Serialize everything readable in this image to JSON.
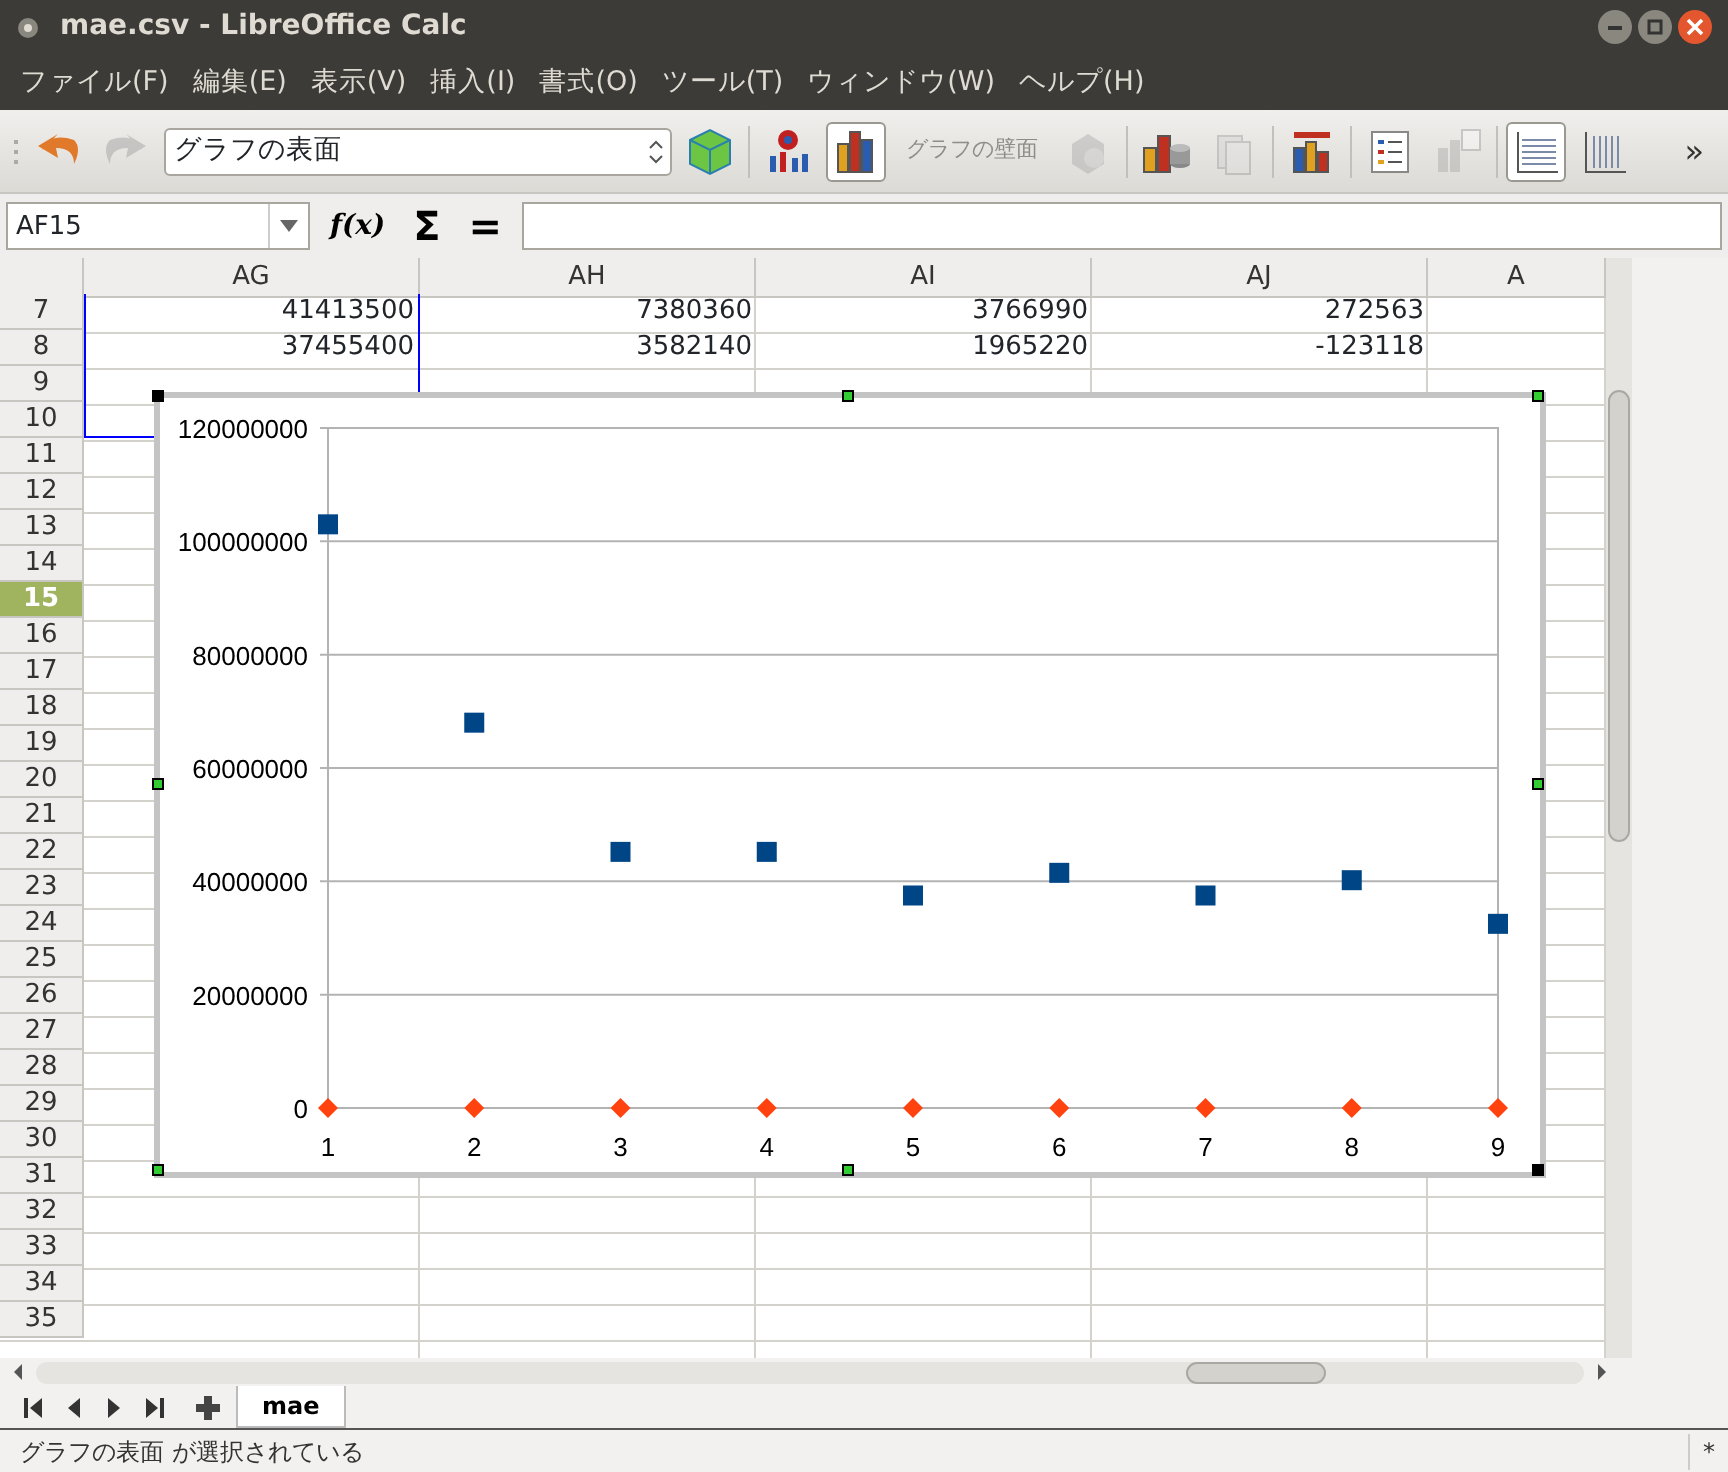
{
  "window": {
    "title": "mae.csv - LibreOffice Calc"
  },
  "menu": [
    {
      "label": "ファイル(F)"
    },
    {
      "label": "編集(E)"
    },
    {
      "label": "表示(V)"
    },
    {
      "label": "挿入(I)"
    },
    {
      "label": "書式(O)"
    },
    {
      "label": "ツール(T)"
    },
    {
      "label": "ウィンドウ(W)"
    },
    {
      "label": "ヘルプ(H)"
    }
  ],
  "toolbar": {
    "items": [
      {
        "kind": "undo",
        "disabled": false,
        "selected": false
      },
      {
        "kind": "redo",
        "disabled": true,
        "selected": false
      },
      {
        "kind": "select",
        "value": "グラフの表面"
      },
      {
        "kind": "cube",
        "disabled": false,
        "selected": false
      },
      {
        "kind": "separator"
      },
      {
        "kind": "charttype",
        "disabled": false,
        "selected": false
      },
      {
        "kind": "bars",
        "disabled": false,
        "selected": true
      },
      {
        "kind": "text",
        "label": "グラフの壁面",
        "disabled": true
      },
      {
        "kind": "threed",
        "disabled": true,
        "selected": false
      },
      {
        "kind": "separator"
      },
      {
        "kind": "datatable",
        "disabled": false,
        "selected": false
      },
      {
        "kind": "sheet",
        "disabled": true,
        "selected": false
      },
      {
        "kind": "separator"
      },
      {
        "kind": "title",
        "disabled": false,
        "selected": false
      },
      {
        "kind": "separator"
      },
      {
        "kind": "legend",
        "disabled": false,
        "selected": false
      },
      {
        "kind": "legendpos",
        "disabled": true,
        "selected": false
      },
      {
        "kind": "separator"
      },
      {
        "kind": "hgrid",
        "disabled": false,
        "selected": true
      },
      {
        "kind": "vgrid",
        "disabled": false,
        "selected": false
      },
      {
        "kind": "more",
        "label": "»"
      }
    ]
  },
  "formula_bar": {
    "name_box": "AF15",
    "function_button": "f(x)",
    "sum_button": "Σ",
    "equals_button": "="
  },
  "sheet": {
    "columns": [
      "AG",
      "AH",
      "AI",
      "AJ",
      "A"
    ],
    "rows": [
      {
        "number": "7",
        "selected": false,
        "range_marked": true,
        "cells": [
          "41413500",
          "7380360",
          "3766990",
          "272563",
          ""
        ]
      },
      {
        "number": "8",
        "selected": false,
        "range_marked": true,
        "cells": [
          "37455400",
          "3582140",
          "1965220",
          "-123118",
          ""
        ]
      },
      {
        "number": "9",
        "selected": false,
        "range_marked": true
      },
      {
        "number": "10",
        "selected": false,
        "range_marked": true
      },
      {
        "number": "11",
        "selected": false,
        "range_marked": false
      },
      {
        "number": "12",
        "selected": false,
        "range_marked": false
      },
      {
        "number": "13",
        "selected": false,
        "range_marked": false
      },
      {
        "number": "14",
        "selected": false,
        "range_marked": false
      },
      {
        "number": "15",
        "selected": true,
        "range_marked": false
      },
      {
        "number": "16",
        "selected": false,
        "range_marked": false
      },
      {
        "number": "17",
        "selected": false,
        "range_marked": false
      },
      {
        "number": "18",
        "selected": false,
        "range_marked": false
      },
      {
        "number": "19",
        "selected": false,
        "range_marked": false
      },
      {
        "number": "20",
        "selected": false,
        "range_marked": false
      },
      {
        "number": "21",
        "selected": false,
        "range_marked": false
      },
      {
        "number": "22",
        "selected": false,
        "range_marked": false
      },
      {
        "number": "23",
        "selected": false,
        "range_marked": false
      },
      {
        "number": "24",
        "selected": false,
        "range_marked": false
      },
      {
        "number": "25",
        "selected": false,
        "range_marked": false
      },
      {
        "number": "26",
        "selected": false,
        "range_marked": false
      },
      {
        "number": "27",
        "selected": false,
        "range_marked": false
      },
      {
        "number": "28",
        "selected": false,
        "range_marked": false
      },
      {
        "number": "29",
        "selected": false,
        "range_marked": false
      },
      {
        "number": "30",
        "selected": false,
        "range_marked": false
      },
      {
        "number": "31",
        "selected": false,
        "range_marked": false
      },
      {
        "number": "32",
        "selected": false,
        "range_marked": false
      },
      {
        "number": "33",
        "selected": false,
        "range_marked": false
      },
      {
        "number": "34",
        "selected": false,
        "range_marked": false
      },
      {
        "number": "35",
        "selected": false,
        "range_marked": false
      }
    ],
    "chart": {
      "selected": true,
      "chart_data": {
        "type": "scatter",
        "grid": true,
        "x": [
          1,
          2,
          3,
          4,
          5,
          6,
          7,
          8,
          9
        ],
        "xlim": [
          1,
          9
        ],
        "ylim": [
          0,
          120000000
        ],
        "xticks": [
          1,
          2,
          3,
          4,
          5,
          6,
          7,
          8,
          9
        ],
        "yticks": [
          0,
          20000000,
          40000000,
          60000000,
          80000000,
          100000000,
          120000000
        ],
        "series": [
          {
            "color": "#004586",
            "values": [
              103000000,
              68000000,
              45200000,
              45200000,
              37500000,
              41500000,
              37500000,
              40200000,
              32500000
            ]
          },
          {
            "color": "#ff420e",
            "values": [
              0,
              0,
              0,
              0,
              0,
              0,
              0,
              0,
              0
            ]
          }
        ]
      }
    }
  },
  "sheet_tabs": [
    {
      "label": "mae",
      "selected": true
    }
  ],
  "status_bar": {
    "message": "グラフの表面 が選択されている",
    "modified": "*"
  }
}
